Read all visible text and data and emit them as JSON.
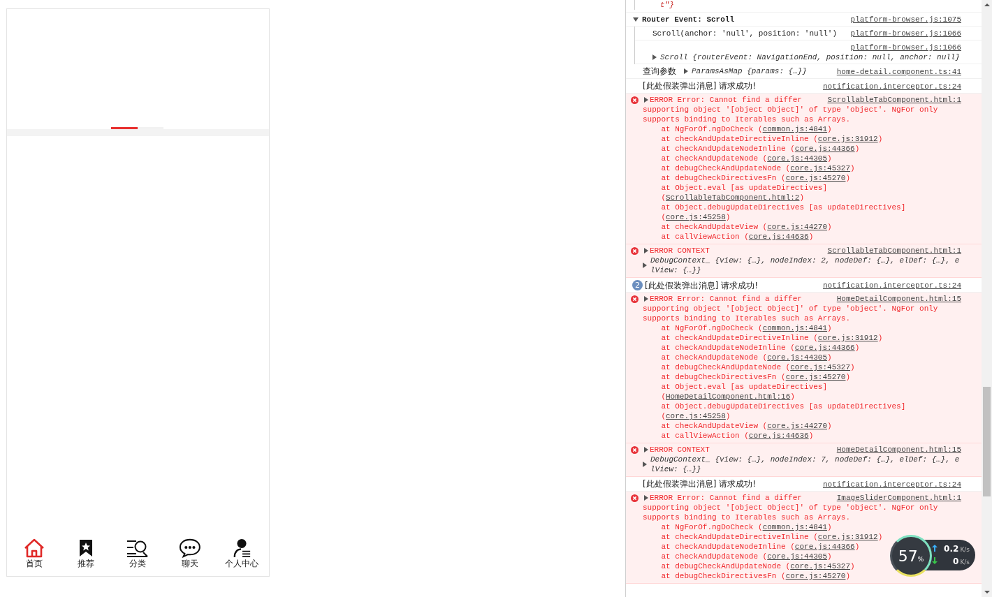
{
  "app": {
    "nav": [
      {
        "label": "首页",
        "selected": true
      },
      {
        "label": "推荐",
        "selected": false
      },
      {
        "label": "分类",
        "selected": false
      },
      {
        "label": "聊天",
        "selected": false
      },
      {
        "label": "个人中心",
        "selected": false
      }
    ]
  },
  "console": {
    "entries": [
      {
        "kind": "fragment",
        "text": "t\"}"
      },
      {
        "kind": "group",
        "expanded": true,
        "text": "Router Event: Scroll",
        "source": "platform-browser.js:1075",
        "children": [
          {
            "kind": "log",
            "text": "Scroll(anchor: 'null', position: 'null')",
            "source": "platform-browser.js:1066"
          },
          {
            "kind": "object",
            "source": "platform-browser.js:1066",
            "object": {
              "expanded": false,
              "text": "Scroll {routerEvent: NavigationEnd, position: null, anchor: null}"
            }
          }
        ]
      },
      {
        "kind": "log",
        "text": "查询参数",
        "object": {
          "expanded": false,
          "text": "ParamsAsMap {params: {…}}"
        },
        "source": "home-detail.component.ts:41"
      },
      {
        "kind": "log",
        "text": "[此处假装弹出消息] 请求成功!",
        "source": "notification.interceptor.ts:24"
      },
      {
        "kind": "error",
        "expanded": false,
        "message_lines": [
          "ERROR Error: Cannot find a differ",
          "supporting object '[object Object]' of type 'object'. NgFor only",
          "supports binding to Iterables such as Arrays."
        ],
        "source": "ScrollableTabComponent.html:1",
        "stack": [
          {
            "text": "at NgForOf.ngDoCheck (",
            "link": "common.js:4841",
            "after": ")"
          },
          {
            "text": "at checkAndUpdateDirectiveInline (",
            "link": "core.js:31912",
            "after": ")"
          },
          {
            "text": "at checkAndUpdateNodeInline (",
            "link": "core.js:44366",
            "after": ")"
          },
          {
            "text": "at checkAndUpdateNode (",
            "link": "core.js:44305",
            "after": ")"
          },
          {
            "text": "at debugCheckAndUpdateNode (",
            "link": "core.js:45327",
            "after": ")"
          },
          {
            "text": "at debugCheckDirectivesFn (",
            "link": "core.js:45270",
            "after": ")"
          },
          {
            "text": "at Object.eval [as updateDirectives] (",
            "link": "ScrollableTabComponent.html:2",
            "after": ")"
          },
          {
            "text": "at Object.debugUpdateDirectives [as updateDirectives] (",
            "link": "core.js:45258",
            "after": ")"
          },
          {
            "text": "at checkAndUpdateView (",
            "link": "core.js:44270",
            "after": ")"
          },
          {
            "text": "at callViewAction (",
            "link": "core.js:44636",
            "after": ")"
          }
        ]
      },
      {
        "kind": "context",
        "expanded": false,
        "text": "ERROR CONTEXT",
        "source": "ScrollableTabComponent.html:1",
        "object": {
          "expanded": false,
          "text": "DebugContext_ {view: {…}, nodeIndex: 2, nodeDef: {…}, elDef: {…}, elView: {…}}"
        }
      },
      {
        "kind": "log",
        "count": "2",
        "text": "[此处假装弹出消息] 请求成功!",
        "source": "notification.interceptor.ts:24"
      },
      {
        "kind": "error",
        "expanded": false,
        "message_lines": [
          "ERROR Error: Cannot find a differ",
          "supporting object '[object Object]' of type 'object'. NgFor only",
          "supports binding to Iterables such as Arrays."
        ],
        "source": "HomeDetailComponent.html:15",
        "stack": [
          {
            "text": "at NgForOf.ngDoCheck (",
            "link": "common.js:4841",
            "after": ")"
          },
          {
            "text": "at checkAndUpdateDirectiveInline (",
            "link": "core.js:31912",
            "after": ")"
          },
          {
            "text": "at checkAndUpdateNodeInline (",
            "link": "core.js:44366",
            "after": ")"
          },
          {
            "text": "at checkAndUpdateNode (",
            "link": "core.js:44305",
            "after": ")"
          },
          {
            "text": "at debugCheckAndUpdateNode (",
            "link": "core.js:45327",
            "after": ")"
          },
          {
            "text": "at debugCheckDirectivesFn (",
            "link": "core.js:45270",
            "after": ")"
          },
          {
            "text": "at Object.eval [as updateDirectives] (",
            "link": "HomeDetailComponent.html:16",
            "after": ")"
          },
          {
            "text": "at Object.debugUpdateDirectives [as updateDirectives] (",
            "link": "core.js:45258",
            "after": ")"
          },
          {
            "text": "at checkAndUpdateView (",
            "link": "core.js:44270",
            "after": ")"
          },
          {
            "text": "at callViewAction (",
            "link": "core.js:44636",
            "after": ")"
          }
        ]
      },
      {
        "kind": "context",
        "expanded": false,
        "text": "ERROR CONTEXT",
        "source": "HomeDetailComponent.html:15",
        "object": {
          "expanded": false,
          "text": "DebugContext_ {view: {…}, nodeIndex: 7, nodeDef: {…}, elDef: {…}, elView: {…}}"
        }
      },
      {
        "kind": "log",
        "text": "[此处假装弹出消息] 请求成功!",
        "source": "notification.interceptor.ts:24"
      },
      {
        "kind": "error",
        "expanded": false,
        "message_lines": [
          "ERROR Error: Cannot find a differ",
          "supporting object '[object Object]' of type 'object'. NgFor only",
          "supports binding to Iterables such as Arrays."
        ],
        "source": "ImageSliderComponent.html:1",
        "stack": [
          {
            "text": "at NgForOf.ngDoCheck (",
            "link": "common.js:4841",
            "after": ")"
          },
          {
            "text": "at checkAndUpdateDirectiveInline (",
            "link": "core.js:31912",
            "after": ")"
          },
          {
            "text": "at checkAndUpdateNodeInline (",
            "link": "core.js:44366",
            "after": ")"
          },
          {
            "text": "at checkAndUpdateNode (",
            "link": "core.js:44305",
            "after": ")"
          },
          {
            "text": "at debugCheckAndUpdateNode (",
            "link": "core.js:45327",
            "after": ")"
          },
          {
            "text": "at debugCheckDirectivesFn (",
            "link": "core.js:45270",
            "after": ")"
          }
        ]
      }
    ]
  },
  "speed_widget": {
    "percent": "57",
    "percent_unit": "%",
    "upload": "0.2",
    "upload_unit": "K/s",
    "download": "0",
    "download_unit": "K/s"
  }
}
